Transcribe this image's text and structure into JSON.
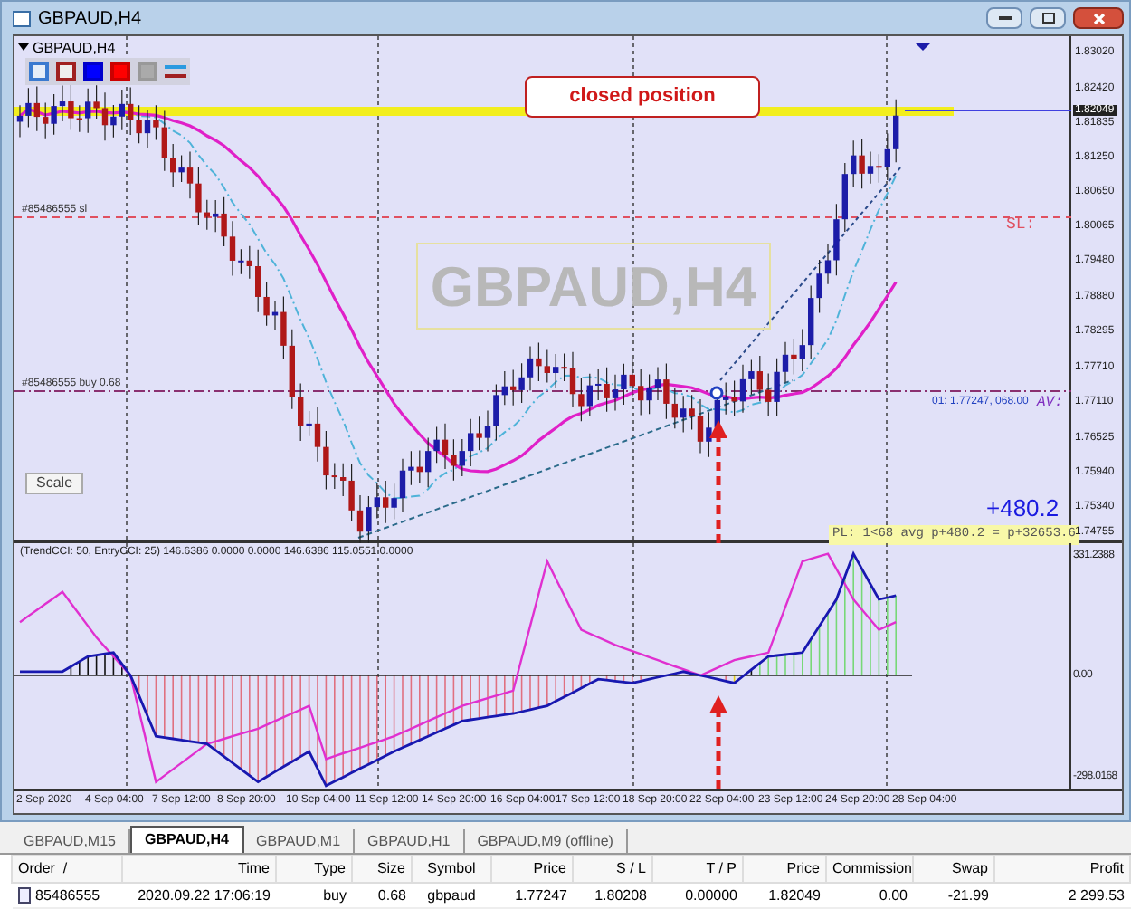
{
  "window": {
    "title": "GBPAUD,H4"
  },
  "chart": {
    "symbol_label": "GBPAUD,H4",
    "watermark": "GBPAUD,H4",
    "closed_label": "closed position",
    "sl_line_label": "#85486555 sl",
    "sl_tag": "SL:",
    "buy_line_label": "#85486555 buy 0.68",
    "order_info": "01: 1.77247, 068.00",
    "av_tag": "AV:",
    "scale_button": "Scale",
    "profit": "+480.2",
    "pl_summary": "PL: 1<68 avg p+480.2 = p+32653.6",
    "price_axis": [
      {
        "label": "1.83020",
        "kind": "tick"
      },
      {
        "label": "1.82420",
        "kind": "tick"
      },
      {
        "label": "1.82049",
        "kind": "current"
      },
      {
        "label": "1.81835",
        "kind": "tick"
      },
      {
        "label": "1.81250",
        "kind": "tick"
      },
      {
        "label": "1.80650",
        "kind": "tick"
      },
      {
        "label": "1.80065",
        "kind": "tick"
      },
      {
        "label": "1.79480",
        "kind": "tick"
      },
      {
        "label": "1.78880",
        "kind": "tick"
      },
      {
        "label": "1.78295",
        "kind": "tick"
      },
      {
        "label": "1.77710",
        "kind": "tick"
      },
      {
        "label": "1.77110",
        "kind": "tick"
      },
      {
        "label": "1.76525",
        "kind": "tick"
      },
      {
        "label": "1.75940",
        "kind": "tick"
      },
      {
        "label": "1.75340",
        "kind": "tick"
      },
      {
        "label": "1.74755",
        "kind": "tick"
      }
    ]
  },
  "indicator": {
    "label": "(TrendCCI: 50, EntryCCI: 25) 146.6386 0.0000 0.0000 146.6386 115.0551 0.0000",
    "axis": [
      "331.2388",
      "0.00",
      "-298.0168"
    ]
  },
  "time_axis": [
    "2 Sep 2020",
    "4 Sep 04:00",
    "7 Sep 12:00",
    "8 Sep 20:00",
    "10 Sep 04:00",
    "11 Sep 12:00",
    "14 Sep 20:00",
    "16 Sep 04:00",
    "17 Sep 12:00",
    "18 Sep 20:00",
    "22 Sep 04:00",
    "23 Sep 12:00",
    "24 Sep 20:00",
    "28 Sep 04:00"
  ],
  "tabs": [
    {
      "label": "GBPAUD,M15",
      "selected": false
    },
    {
      "label": "GBPAUD,H4",
      "selected": true
    },
    {
      "label": "GBPAUD,M1",
      "selected": false
    },
    {
      "label": "GBPAUD,H1",
      "selected": false
    },
    {
      "label": "GBPAUD,M9 (offline)",
      "selected": false
    }
  ],
  "table": {
    "columns": [
      "Order  /",
      "Time",
      "Type",
      "Size",
      "Symbol",
      "Price",
      "S / L",
      "T / P",
      "Price",
      "Commission",
      "Swap",
      "Profit"
    ],
    "rows": [
      [
        "85486555",
        "2020.09.22 17:06:19",
        "buy",
        "0.68",
        "gbpaud",
        "1.77247",
        "1.80208",
        "0.00000",
        "1.82049",
        "0.00",
        "-21.99",
        "2 299.53"
      ]
    ]
  }
}
